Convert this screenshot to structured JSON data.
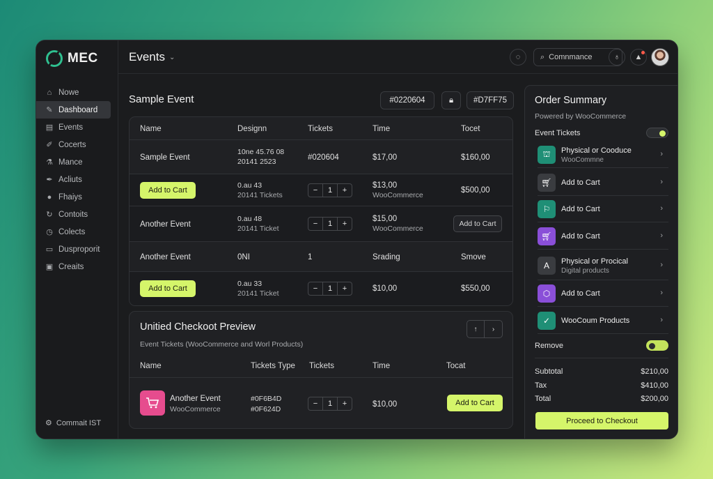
{
  "app": {
    "logo": "MEC",
    "title": "Events"
  },
  "colors": {
    "accent": "#d5f56a",
    "background": "#1b1c1e",
    "teal": "#1f8f76",
    "pink": "#e64c8e",
    "purple": "#8a4fd8"
  },
  "sidebar": {
    "items": [
      {
        "label": "Nowe",
        "icon": "home-icon"
      },
      {
        "label": "Dashboard",
        "icon": "wand-icon",
        "active": true
      },
      {
        "label": "Events",
        "icon": "document-icon"
      },
      {
        "label": "Cocerts",
        "icon": "brush-icon"
      },
      {
        "label": "Mance",
        "icon": "flask-icon"
      },
      {
        "label": "Acliuts",
        "icon": "pen-icon"
      },
      {
        "label": "Fhaiys",
        "icon": "user-icon"
      },
      {
        "label": "Contoits",
        "icon": "refresh-icon"
      },
      {
        "label": "Colects",
        "icon": "clock-icon"
      },
      {
        "label": "Dusproporit",
        "icon": "folder-icon"
      },
      {
        "label": "Creaits",
        "icon": "card-icon"
      }
    ],
    "footer": "Commait IST"
  },
  "header": {
    "search_placeholder": "Comnmance"
  },
  "event": {
    "title": "Sample Event",
    "pill1": "#0220604",
    "pill2": "#D7FF75"
  },
  "table": {
    "headers": [
      "Name",
      "Designn",
      "Tickets",
      "Time",
      "Tocet"
    ],
    "rows": [
      {
        "name": "Sample Event",
        "design1": "10ne 45.76 08",
        "design2": "20141 2523",
        "tickets": "#020604",
        "time1": "$17,00",
        "time2": "",
        "total": "$160,00"
      },
      {
        "button": "Add to Cart",
        "design1": "0.au 43",
        "design2": "20141 Tickets",
        "qty": "1",
        "time1": "$13,00",
        "time2": "WooCommerce",
        "total": "$500,00"
      },
      {
        "name": "Another Event",
        "design1": "0.au 48",
        "design2": "20141 Ticket",
        "qty": "1",
        "time1": "$15,00",
        "time2": "WooCommerce",
        "button2": "Add to Cart"
      },
      {
        "name": "Another Event",
        "design1": "0NI",
        "design2": "",
        "tickets": "1",
        "time1": "Srading",
        "time2": "",
        "total": "Smove"
      },
      {
        "button": "Add to Cart",
        "design1": "0.au 33",
        "design2": "20141 Ticket",
        "qty": "1",
        "time1": "$10,00",
        "time2": "",
        "total": "$550,00"
      }
    ]
  },
  "checkout": {
    "title": "Unitied Checkoot Preview",
    "subtitle": "Event Tickets (WooCommerce and Worl Products)",
    "headers": [
      "Name",
      "Tickets Type",
      "Tickets",
      "Time",
      "Tocat"
    ],
    "row": {
      "name": "Another Event",
      "sub": "WooCommerce",
      "type1": "#0F6B4D",
      "type2": "#0F624D",
      "qty": "1",
      "time": "$10,00",
      "button": "Add to Cart"
    }
  },
  "order": {
    "title": "Order Summary",
    "powered": "Powered by WooCommerce",
    "event_tickets_label": "Event Tickets",
    "remove_label": "Remove",
    "items": [
      {
        "name": "Physical or Cooduce",
        "desc": "WooCommne",
        "color": "#1f8f76",
        "icon": "store-icon"
      },
      {
        "name": "Add to Cart",
        "desc": "",
        "color": "#3a3c40",
        "icon": "cart-icon"
      },
      {
        "name": "Add to Cart",
        "desc": "",
        "color": "#1f8f76",
        "icon": "bag-icon"
      },
      {
        "name": "Add to Cart",
        "desc": "",
        "color": "#8a4fd8",
        "icon": "cart-icon"
      },
      {
        "name": "Physical or Procical",
        "desc": "Digital products",
        "color": "#3a3c40",
        "icon": "letter-a-icon"
      },
      {
        "name": "Add to Cart",
        "desc": "",
        "color": "#8a4fd8",
        "icon": "hexagon-icon"
      },
      {
        "name": "WooCoum Products",
        "desc": "",
        "color": "#1f8f76",
        "icon": "check-icon"
      }
    ],
    "summary": [
      {
        "label": "Subtotal",
        "value": "$210,00"
      },
      {
        "label": "Tax",
        "value": "$410,00"
      },
      {
        "label": "Total",
        "value": "$200,00"
      }
    ],
    "proceed": "Proceed to Checkout"
  }
}
